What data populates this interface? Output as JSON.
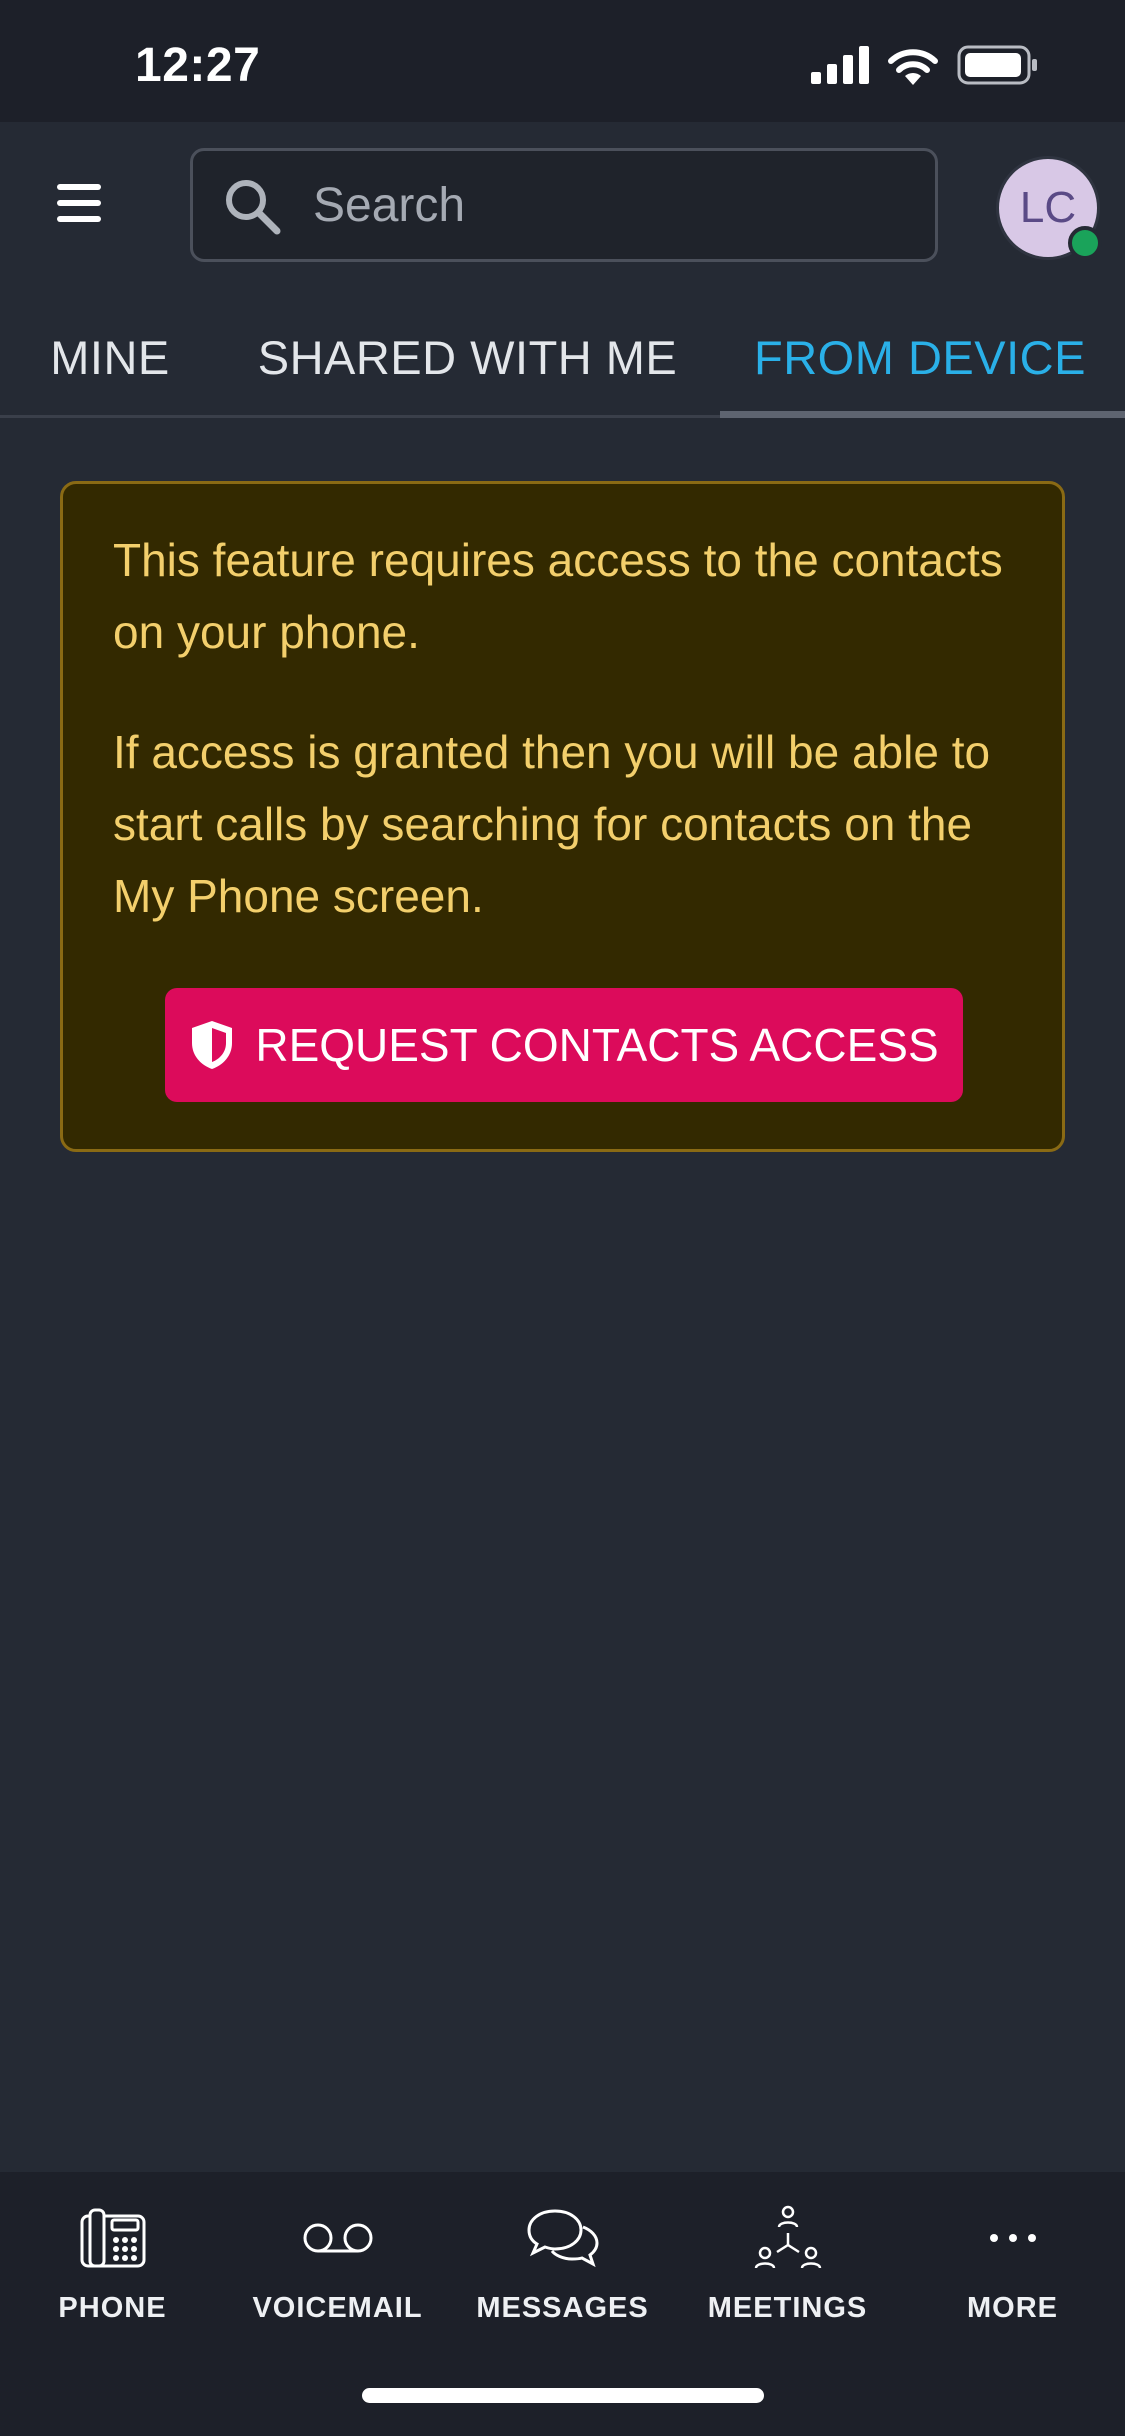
{
  "status_bar": {
    "time": "12:27"
  },
  "header": {
    "search_placeholder": "Search",
    "avatar_initials": "LC"
  },
  "tabs": [
    {
      "label": "MINE",
      "active": false
    },
    {
      "label": "SHARED WITH ME",
      "active": false
    },
    {
      "label": "FROM DEVICE",
      "active": true
    }
  ],
  "notice": {
    "paragraph_1": "This feature requires access to the contacts on your phone.",
    "paragraph_2": "If access is granted then you will be able to start calls by searching for contacts on the My Phone screen.",
    "button_label": "REQUEST CONTACTS ACCESS"
  },
  "bottom_nav": [
    {
      "label": "PHONE",
      "icon": "desk-phone-icon"
    },
    {
      "label": "VOICEMAIL",
      "icon": "voicemail-icon"
    },
    {
      "label": "MESSAGES",
      "icon": "chat-bubbles-icon"
    },
    {
      "label": "MEETINGS",
      "icon": "meeting-people-icon"
    },
    {
      "label": "MORE",
      "icon": "more-dots-icon"
    }
  ],
  "colors": {
    "accent_tab": "#2ab0e8",
    "button_bg": "#dc0b5b",
    "notice_bg": "#332900",
    "notice_text": "#f3cf6c",
    "presence": "#1aa35a"
  }
}
